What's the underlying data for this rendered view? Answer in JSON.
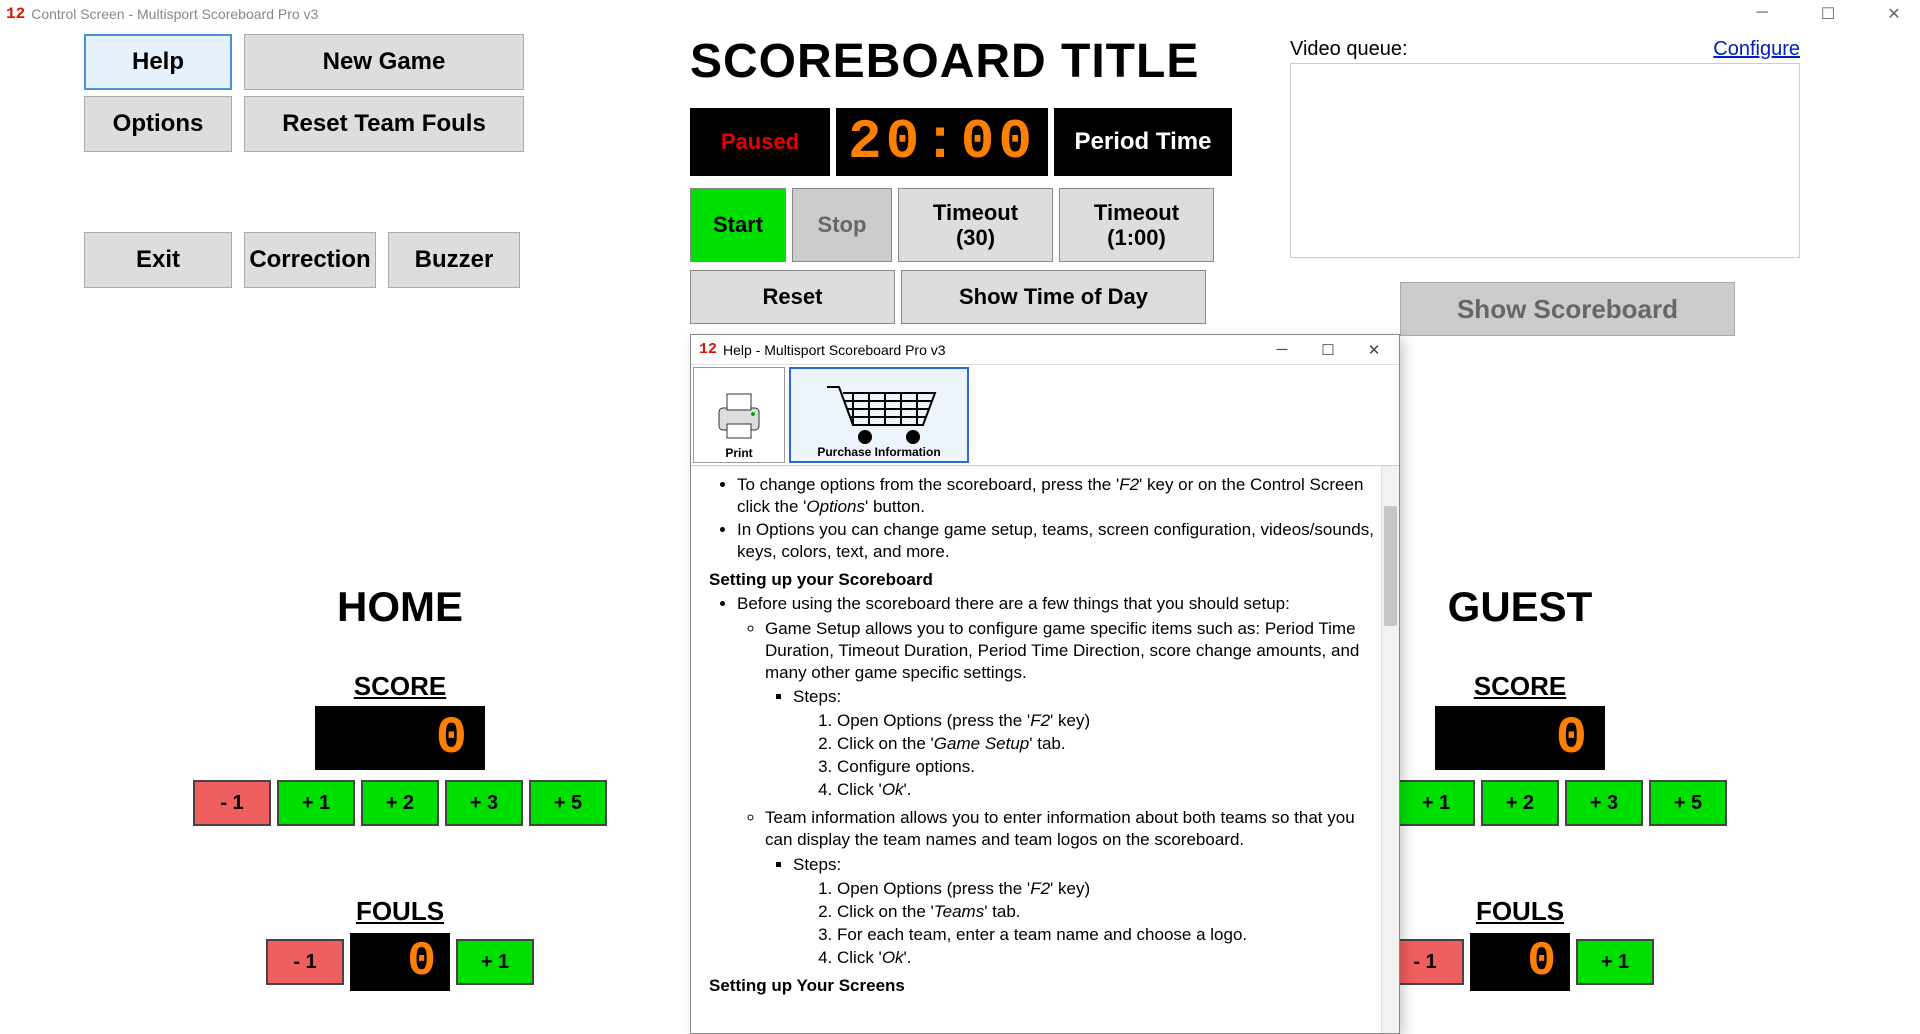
{
  "app": {
    "main_title": "Control Screen - Multisport Scoreboard Pro v3",
    "logo": "12"
  },
  "toolbar": {
    "help": "Help",
    "new_game": "New Game",
    "options": "Options",
    "reset_fouls": "Reset Team Fouls",
    "exit": "Exit",
    "correction": "Correction",
    "buzzer": "Buzzer"
  },
  "title_text": "SCOREBOARD TITLE",
  "clock": {
    "paused": "Paused",
    "time": "20:00",
    "period_label": "Period Time",
    "start": "Start",
    "stop": "Stop",
    "timeout30_l1": "Timeout",
    "timeout30_l2": "(30)",
    "timeout100_l1": "Timeout",
    "timeout100_l2": "(1:00)",
    "reset": "Reset",
    "show_tod": "Show Time of Day"
  },
  "video": {
    "label": "Video queue:",
    "configure": "Configure"
  },
  "show_scoreboard": "Show Scoreboard",
  "teams": {
    "home": {
      "name": "HOME",
      "score_label": "SCORE",
      "score": "0",
      "fouls_label": "FOULS",
      "fouls": "0"
    },
    "guest": {
      "name": "GUEST",
      "score_label": "SCORE",
      "score": "0",
      "fouls_label": "FOULS",
      "fouls": "0"
    }
  },
  "score_buttons": {
    "minus1": "- 1",
    "plus1": "+ 1",
    "plus2": "+ 2",
    "plus3": "+ 3",
    "plus5": "+ 5"
  },
  "help_window": {
    "title": "Help - Multisport Scoreboard Pro v3",
    "print": "Print",
    "purchase": "Purchase Information",
    "b1a": "To change options from the scoreboard, press the '",
    "b1b": "F2",
    "b1c": "' key or on the Control Screen click the '",
    "b1d": "Options",
    "b1e": "' button.",
    "b2": "In Options you can change game setup, teams, screen configuration, videos/sounds, keys, colors, text, and more.",
    "h1": "Setting up your Scoreboard",
    "b3": "Before using the scoreboard there are a few things that you should setup:",
    "b4": "Game Setup allows you to configure game specific items such as: Period Time Duration, Timeout Duration, Period Time Direction, score change amounts, and many other game specific settings.",
    "steps": "Steps:",
    "s1a": "Open Options (press the '",
    "s1b": "F2",
    "s1c": "' key)",
    "s2a": "Click on the '",
    "s2b": "Game Setup",
    "s2c": "' tab.",
    "s3": "Configure options.",
    "s4a": "Click '",
    "s4b": "Ok",
    "s4c": "'.",
    "b5": "Team information allows you to enter information about both teams so that you can display the team names and team logos on the scoreboard.",
    "t2a": "Click on the '",
    "t2b": "Teams",
    "t2c": "' tab.",
    "t3": "For each team, enter a team name and choose a logo.",
    "h2": "Setting up Your Screens"
  }
}
